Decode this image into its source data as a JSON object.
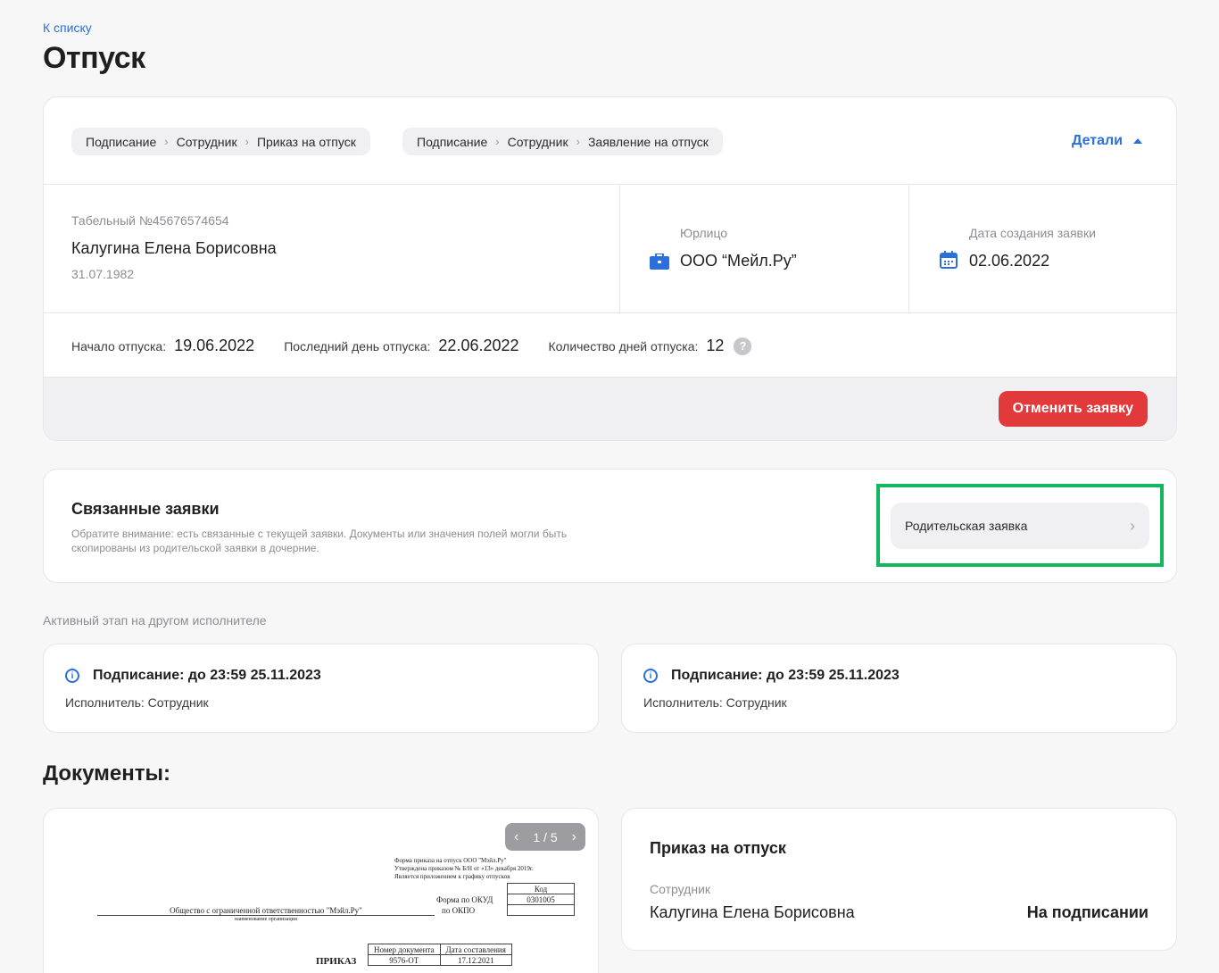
{
  "header": {
    "back_link": "К списку",
    "title": "Отпуск"
  },
  "request": {
    "chips": [
      {
        "items": [
          "Подписание",
          "Сотрудник",
          "Приказ на отпуск"
        ]
      },
      {
        "items": [
          "Подписание",
          "Сотрудник",
          "Заявление на отпуск"
        ]
      }
    ],
    "details_label": "Детали",
    "employee": {
      "tab_number": "Табельный №45676574654",
      "name": "Калугина Елена Борисовна",
      "birth_date": "31.07.1982"
    },
    "legal_entity": {
      "label": "Юрлицо",
      "value": "ООО “Мейл.Ру”"
    },
    "created": {
      "label": "Дата создания заявки",
      "value": "02.06.2022"
    },
    "vacation": {
      "start_label": "Начало отпуска:",
      "start_value": "19.06.2022",
      "end_label": "Последний день отпуска:",
      "end_value": "22.06.2022",
      "days_label": "Количество дней отпуска:",
      "days_value": "12"
    },
    "cancel_button": "Отменить заявку"
  },
  "related": {
    "title": "Связанные заявки",
    "description_line1": "Обратите внимание: есть связанные с текущей заявки. Документы или значения полей могли быть",
    "description_line2": "скопированы из родительской заявки в дочерние.",
    "parent_button": "Родительская заявка",
    "highlight_color": "#12b75f"
  },
  "active_stage": {
    "caption": "Активный этап на другом исполнителе",
    "cards": [
      {
        "title": "Подписание: до 23:59 25.11.2023",
        "executor": "Исполнитель: Сотрудник"
      },
      {
        "title": "Подписание: до 23:59 25.11.2023",
        "executor": "Исполнитель: Сотрудник"
      }
    ]
  },
  "documents": {
    "title": "Документы:",
    "pager": "1 / 5",
    "preview": {
      "form_note_1": "Форма приказа на отпуск ООО \"Мэйл.Ру\"",
      "form_note_2": "Утверждена приказом № Б/Н от «13» декабря 2019г.",
      "form_note_3": "Является приложением к графику отпусков",
      "code_header": "Код",
      "okud_label": "Форма по ОКУД",
      "okud_value": "0301005",
      "okpo_label": "по ОКПО",
      "org_name": "Общество с ограниченной ответственностью \"Мэйл.Ру\"",
      "org_caption": "наименование организации",
      "doc_number_header": "Номер документа",
      "doc_date_header": "Дата составления",
      "order_word": "ПРИКАЗ",
      "doc_number": "9576-ОТ",
      "doc_date": "17.12.2021"
    },
    "order_card": {
      "title": "Приказ на отпуск",
      "role": "Сотрудник",
      "name": "Калугина Елена Борисовна",
      "status": "На подписании"
    }
  }
}
